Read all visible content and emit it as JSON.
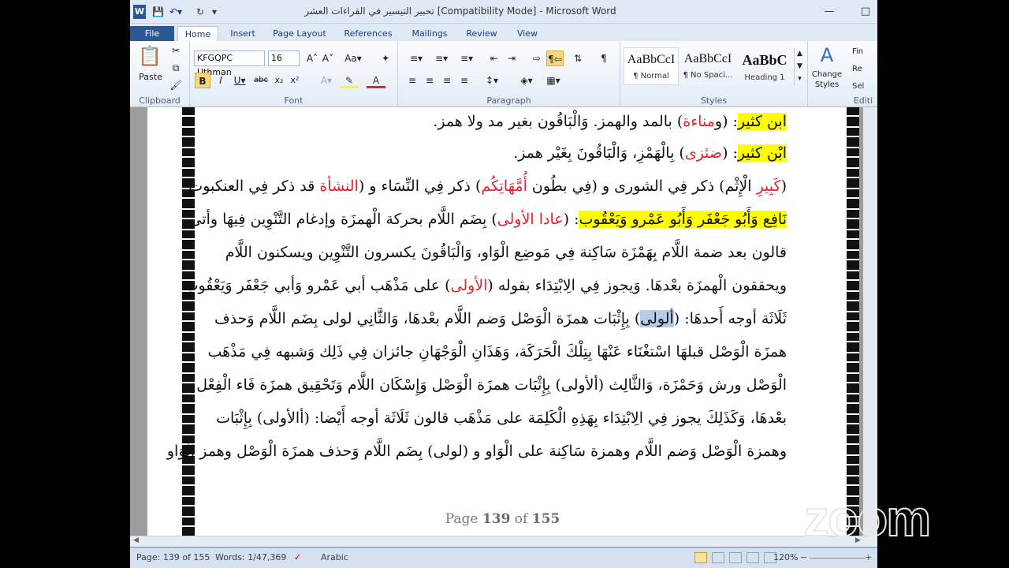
{
  "window": {
    "title": "تحبير التيسير في القراءات العشر [Compatibility Mode]  -  Microsoft Word"
  },
  "tabs": [
    "File",
    "Home",
    "Insert",
    "Page Layout",
    "References",
    "Mailings",
    "Review",
    "View"
  ],
  "clipboard": {
    "paste": "Paste",
    "label": "Clipboard"
  },
  "font": {
    "name": "KFGQPC Uthman",
    "size": "16",
    "label": "Font"
  },
  "paragraph": {
    "label": "Paragraph"
  },
  "styles": {
    "label": "Styles",
    "items": [
      {
        "preview": "AaBbCcI",
        "name": "¶ Normal"
      },
      {
        "preview": "AaBbCcI",
        "name": "¶ No Spaci..."
      },
      {
        "preview": "AaBbC",
        "name": "Heading 1"
      }
    ],
    "change": "Change Styles"
  },
  "editing": {
    "find": "Fin",
    "replace": "Re",
    "select": "Sel",
    "label": "Editi"
  },
  "doc": {
    "l1": {
      "a": "ابن كثير",
      "b": ": (و",
      "c": "مناءة",
      "d": ") بالمد والهمز. وَالْبَاقُون بغير مد ولا همز."
    },
    "l2": {
      "a": "ابْن كثير",
      "b": ": (",
      "c": "ضئزى",
      "d": ") بِالْهَمْزِ، وَالْبَاقُونَ بِغَيْر همز."
    },
    "l3": {
      "a": "(",
      "b": "كَبِيرِ",
      "c": " الْإِثْم) ذكر فِي الشورى و (فِي بطُون ",
      "d": "أُمَّهَاتِكُم",
      "e": ") ذكر فِي النِّسَاء و (",
      "f": "النشأة",
      "g": " قد ذكر فِي العنكبوت."
    },
    "l4": {
      "a": "نَافِع وَأَبُو جَعْفَر وَأَبُو عَمْرو وَيَعْقُوب",
      "b": ": (",
      "c": "عادا الأولى",
      "d": ") بِضَم اللَّام بحركة الْهمزَة وإدغام التَّنْوِين فِيهَا وأتى"
    },
    "l5": "قالون بعد ضمة اللَّام بِهَمْزَة سَاكِنة فِي مَوضِع الْوَاو، وَالْبَاقُونَ يكسرون التَّنْوِين ويسكنون اللَّام",
    "l6": {
      "a": "ويحققون الْهمزَة بعْدهَا. وَيجوز فِي الِابْتِدَاء بقوله (",
      "b": "الأولى",
      "c": ") على مَذْهَب أبي عَمْرو وَأبي جَعْفَر وَيَعْقُوب"
    },
    "l7": {
      "a": "ثَلَاثَة أوجه أَحدهَا: (",
      "b": "ألولى",
      "c": ") بِإِثْبَات همزَة الْوَصْل وَضم اللَّام بعْدهَا، وَالثَّانِي لولى بِضَم اللَّام وَحذف"
    },
    "l8": "همزَة الْوَصْل قبلهَا اسْتغْنَاء عَنْهَا بِتِلْكَ الْحَرَكَة، وَهَذَانِ الْوَجْهَانِ جائزان فِي ذَلِك وَشبهه فِي مَذْهَب",
    "l9": "الْوَصْل ورش وَحَمْزَة، وَالثَّالِث (ألأولى) بِإِثْبَات همزَة الْوَصْل وَإِسْكَان اللَّام وَتَحْقِيق همزَة فَاء الْفِعْل",
    "l10": "بعْدهَا، وَكَذَلِكَ يجوز فِي الِابْتِدَاء بِهَذِهِ الْكَلِمَة على مَذْهَب قالون ثَلَاثَة أوجه أَيْضا: (أالأولى) بِإِثْبَات",
    "l11": "وهمزة الْوَصْل وَضم اللَّام وهمزة سَاكِنة على الْوَاو و (لولى) بِضَم اللَّام وَحذف همزَة الْوَصْل وهمز الْوَاو",
    "page_num": {
      "pre": "Page ",
      "cur": "139",
      "mid": " of ",
      "total": "155"
    }
  },
  "status": {
    "page": "Page: 139 of 155",
    "words": "Words: 1/47,369",
    "lang": "Arabic",
    "zoom": "120%"
  },
  "zoom_watermark": "zoom"
}
